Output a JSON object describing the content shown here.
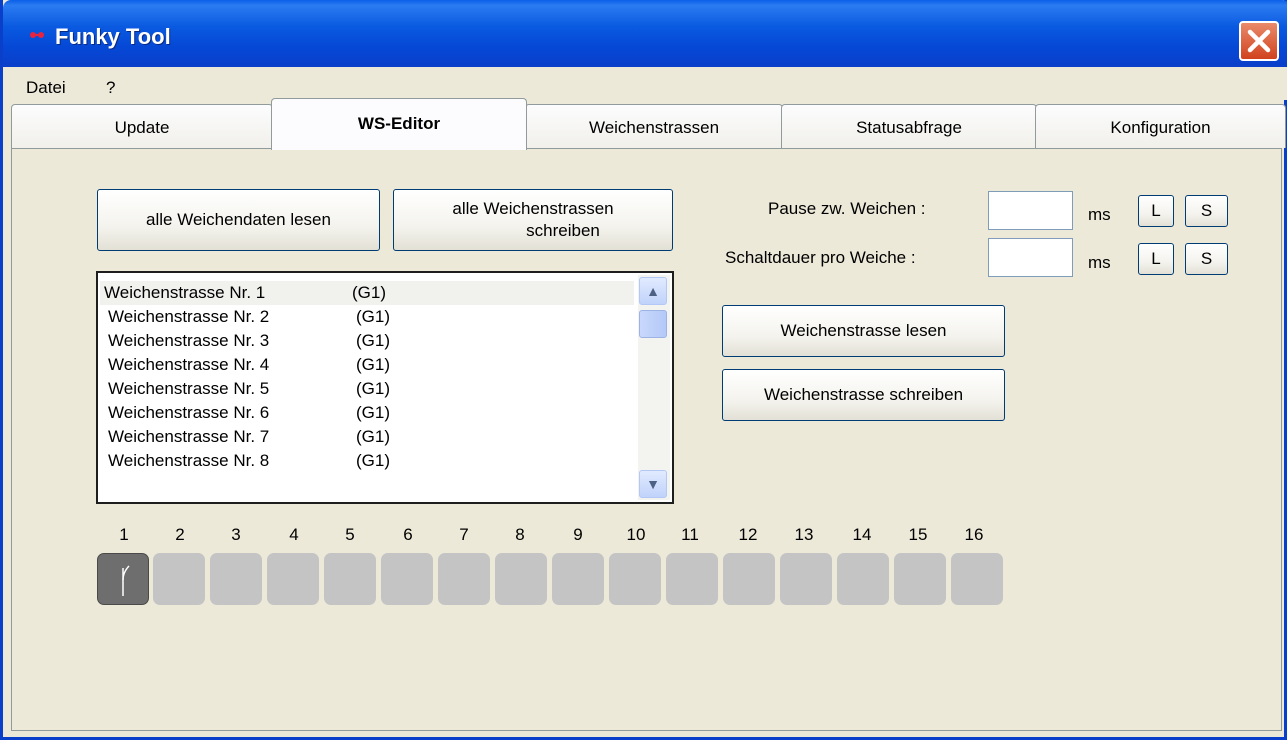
{
  "window": {
    "title": "Funky Tool"
  },
  "menu": [
    "Datei",
    "?"
  ],
  "tabs": [
    "Update",
    "WS-Editor",
    "Weichenstrassen",
    "Statusabfrage",
    "Konfiguration"
  ],
  "active_tab": "WS-Editor",
  "buttons": {
    "read_all": "alle Weichendaten lesen",
    "write_all_line1": "alle Weichenstrassen",
    "write_all_line2": "schreiben",
    "read_route": "Weichenstrasse lesen",
    "write_route": "Weichenstrasse schreiben"
  },
  "settings": {
    "pause_label": "Pause zw. Weichen :",
    "pause_value": "",
    "pause_unit": "ms",
    "duration_label": "Schaltdauer pro Weiche :",
    "duration_value": "",
    "duration_unit": "ms",
    "load_label": "L",
    "save_label": "S"
  },
  "routes": [
    {
      "name": "Weichenstrasse Nr. 1",
      "group": "(G1)"
    },
    {
      "name": "Weichenstrasse Nr. 2",
      "group": "(G1)"
    },
    {
      "name": "Weichenstrasse Nr. 3",
      "group": "(G1)"
    },
    {
      "name": "Weichenstrasse Nr. 4",
      "group": "(G1)"
    },
    {
      "name": "Weichenstrasse Nr. 5",
      "group": "(G1)"
    },
    {
      "name": "Weichenstrasse Nr. 6",
      "group": "(G1)"
    },
    {
      "name": "Weichenstrasse Nr. 7",
      "group": "(G1)"
    },
    {
      "name": "Weichenstrasse Nr. 8",
      "group": "(G1)"
    }
  ],
  "switch_numbers": [
    "1",
    "2",
    "3",
    "4",
    "5",
    "6",
    "7",
    "8",
    "9",
    "10",
    "11",
    "12",
    "13",
    "14",
    "15",
    "16"
  ],
  "colors": {
    "title_bar": "#0A5AE0",
    "close_button": "#D1421E",
    "active_slot": "#6E6E6E",
    "inactive_slot": "#C4C4C4"
  }
}
